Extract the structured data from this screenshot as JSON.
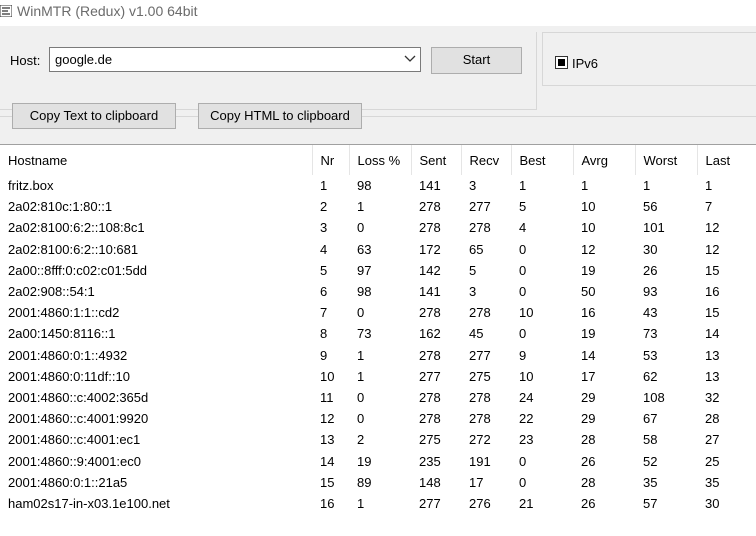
{
  "window": {
    "title": "WinMTR (Redux) v1.00 64bit"
  },
  "host": {
    "label": "Host:",
    "value": "google.de"
  },
  "buttons": {
    "start": "Start",
    "copy_text": "Copy Text to clipboard",
    "copy_html": "Copy HTML to clipboard"
  },
  "ipv6": {
    "label": "IPv6",
    "checked": true
  },
  "table": {
    "headers": [
      "Hostname",
      "Nr",
      "Loss %",
      "Sent",
      "Recv",
      "Best",
      "Avrg",
      "Worst",
      "Last"
    ],
    "rows": [
      [
        "fritz.box",
        "1",
        "98",
        "141",
        "3",
        "1",
        "1",
        "1",
        "1"
      ],
      [
        "2a02:810c:1:80::1",
        "2",
        "1",
        "278",
        "277",
        "5",
        "10",
        "56",
        "7"
      ],
      [
        "2a02:8100:6:2::108:8c1",
        "3",
        "0",
        "278",
        "278",
        "4",
        "10",
        "101",
        "12"
      ],
      [
        "2a02:8100:6:2::10:681",
        "4",
        "63",
        "172",
        "65",
        "0",
        "12",
        "30",
        "12"
      ],
      [
        "2a00::8fff:0:c02:c01:5dd",
        "5",
        "97",
        "142",
        "5",
        "0",
        "19",
        "26",
        "15"
      ],
      [
        "2a02:908::54:1",
        "6",
        "98",
        "141",
        "3",
        "0",
        "50",
        "93",
        "16"
      ],
      [
        "2001:4860:1:1::cd2",
        "7",
        "0",
        "278",
        "278",
        "10",
        "16",
        "43",
        "15"
      ],
      [
        "2a00:1450:8116::1",
        "8",
        "73",
        "162",
        "45",
        "0",
        "19",
        "73",
        "14"
      ],
      [
        "2001:4860:0:1::4932",
        "9",
        "1",
        "278",
        "277",
        "9",
        "14",
        "53",
        "13"
      ],
      [
        "2001:4860:0:11df::10",
        "10",
        "1",
        "277",
        "275",
        "10",
        "17",
        "62",
        "13"
      ],
      [
        "2001:4860::c:4002:365d",
        "11",
        "0",
        "278",
        "278",
        "24",
        "29",
        "108",
        "32"
      ],
      [
        "2001:4860::c:4001:9920",
        "12",
        "0",
        "278",
        "278",
        "22",
        "29",
        "67",
        "28"
      ],
      [
        "2001:4860::c:4001:ec1",
        "13",
        "2",
        "275",
        "272",
        "23",
        "28",
        "58",
        "27"
      ],
      [
        "2001:4860::9:4001:ec0",
        "14",
        "19",
        "235",
        "191",
        "0",
        "26",
        "52",
        "25"
      ],
      [
        "2001:4860:0:1::21a5",
        "15",
        "89",
        "148",
        "17",
        "0",
        "28",
        "35",
        "35"
      ],
      [
        "ham02s17-in-x03.1e100.net",
        "16",
        "1",
        "277",
        "276",
        "21",
        "26",
        "57",
        "30"
      ]
    ]
  }
}
